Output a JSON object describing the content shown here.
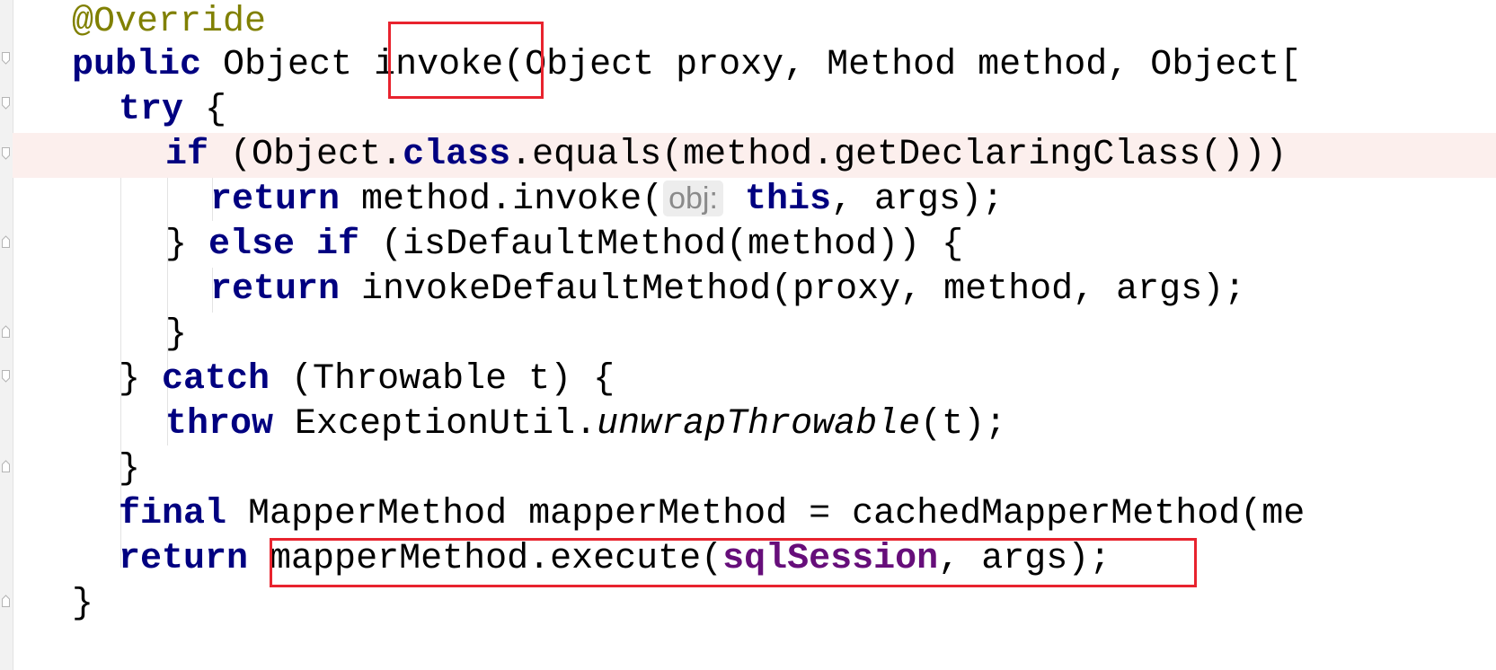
{
  "code": {
    "annotation": "@Override",
    "line1": {
      "kw_public": "public",
      "type_object": " Object ",
      "method_name": "invoke",
      "params": "(Object proxy, Method method, Object["
    },
    "line2": {
      "kw_try": "try",
      "rest": " {"
    },
    "line3": {
      "kw_if": "if",
      "part1": " (Object.",
      "kw_class": "class",
      "part2": ".equals(method.getDeclaringClass()))"
    },
    "line4": {
      "kw_return": "return",
      "part1": " method.invoke(",
      "hint": "obj:",
      "kw_this": "this",
      "part2": ", args);"
    },
    "line5": {
      "brace": "} ",
      "kw_else_if": "else if",
      "rest": " (isDefaultMethod(method)) {"
    },
    "line6": {
      "kw_return": "return",
      "rest": " invokeDefaultMethod(proxy, method, args);"
    },
    "line7": {
      "brace": "}"
    },
    "line8": {
      "brace": "} ",
      "kw_catch": "catch",
      "rest": " (Throwable t) {"
    },
    "line9": {
      "kw_throw": "throw",
      "part1": " ExceptionUtil.",
      "static_call": "unwrapThrowable",
      "part2": "(t);"
    },
    "line10": {
      "brace": "}"
    },
    "line11": {
      "kw_final": "final",
      "rest": " MapperMethod mapperMethod = cachedMapperMethod(me"
    },
    "line12": {
      "kw_return": "return",
      "part1": "mapperMethod.execute(",
      "field": "sqlSession",
      "part2": ", args);"
    },
    "line13": {
      "brace": "}"
    }
  },
  "colors": {
    "keyword": "#000080",
    "annotation": "#808000",
    "field": "#660e7a",
    "highlight_box": "#e8232e",
    "current_line": "#fcefed"
  }
}
